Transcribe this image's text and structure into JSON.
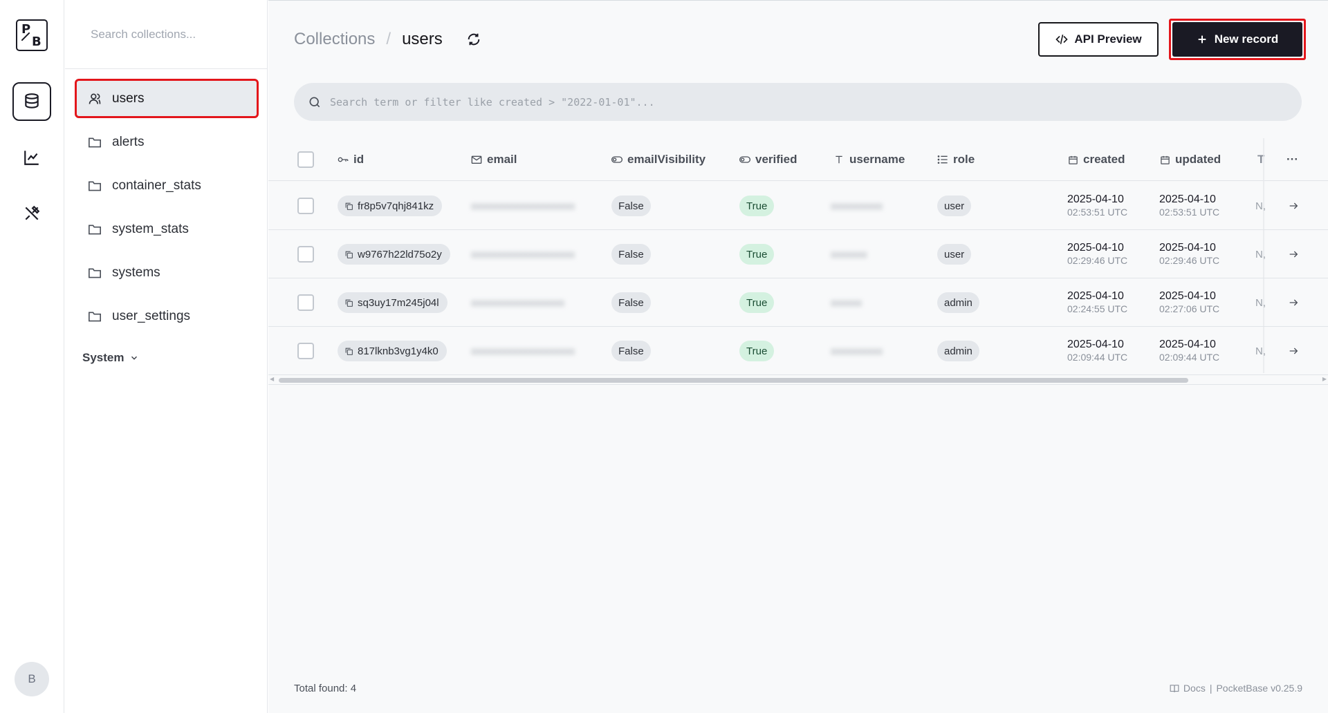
{
  "logo": {
    "letters": [
      "P",
      "B"
    ]
  },
  "rail": {
    "items": [
      {
        "name": "collections",
        "icon": "database-icon",
        "active": true
      },
      {
        "name": "logs",
        "icon": "chart-line-icon",
        "active": false
      },
      {
        "name": "settings",
        "icon": "tools-icon",
        "active": false
      }
    ],
    "avatar_initial": "B"
  },
  "sidebar": {
    "search_placeholder": "Search collections...",
    "collections": [
      {
        "label": "users",
        "icon": "user-icon",
        "active": true
      },
      {
        "label": "alerts",
        "icon": "folder-icon",
        "active": false
      },
      {
        "label": "container_stats",
        "icon": "folder-icon",
        "active": false
      },
      {
        "label": "system_stats",
        "icon": "folder-icon",
        "active": false
      },
      {
        "label": "systems",
        "icon": "folder-icon",
        "active": false
      },
      {
        "label": "user_settings",
        "icon": "folder-icon",
        "active": false
      }
    ],
    "system_label": "System"
  },
  "header": {
    "breadcrumb_root": "Collections",
    "breadcrumb_sep": "/",
    "breadcrumb_current": "users",
    "api_preview_label": "API Preview",
    "new_record_label": "New record"
  },
  "filter": {
    "placeholder": "Search term or filter like created > \"2022-01-01\"..."
  },
  "table": {
    "columns": {
      "id": "id",
      "email": "email",
      "emailVisibility": "emailVisibility",
      "verified": "verified",
      "username": "username",
      "role": "role",
      "created": "created",
      "updated": "updated",
      "truncated": "T",
      "more": "···"
    },
    "rows": [
      {
        "id": "fr8p5v7qhj841kz",
        "email": "[redacted]",
        "emailVisibility": "False",
        "verified": "True",
        "username": "[redacted]",
        "role": "user",
        "created_date": "2025-04-10",
        "created_time": "02:53:51 UTC",
        "updated_date": "2025-04-10",
        "updated_time": "02:53:51 UTC",
        "trunc": "N,"
      },
      {
        "id": "w9767h22ld75o2y",
        "email": "[redacted]",
        "emailVisibility": "False",
        "verified": "True",
        "username": "[redacted]",
        "role": "user",
        "created_date": "2025-04-10",
        "created_time": "02:29:46 UTC",
        "updated_date": "2025-04-10",
        "updated_time": "02:29:46 UTC",
        "trunc": "N,"
      },
      {
        "id": "sq3uy17m245j04l",
        "email": "[redacted]",
        "emailVisibility": "False",
        "verified": "True",
        "username": "[redacted]",
        "role": "admin",
        "created_date": "2025-04-10",
        "created_time": "02:24:55 UTC",
        "updated_date": "2025-04-10",
        "updated_time": "02:27:06 UTC",
        "trunc": "N,"
      },
      {
        "id": "817lknb3vg1y4k0",
        "email": "[redacted]",
        "emailVisibility": "False",
        "verified": "True",
        "username": "[redacted]",
        "role": "admin",
        "created_date": "2025-04-10",
        "created_time": "02:09:44 UTC",
        "updated_date": "2025-04-10",
        "updated_time": "02:09:44 UTC",
        "trunc": "N,"
      }
    ]
  },
  "footer": {
    "total_label": "Total found:",
    "total_value": "4",
    "docs_label": "Docs",
    "separator": "|",
    "version": "PocketBase v0.25.9"
  },
  "colors": {
    "accent_dark": "#1a1a24",
    "highlight_red": "#e3161b",
    "true_badge": "#d4f1e0"
  }
}
